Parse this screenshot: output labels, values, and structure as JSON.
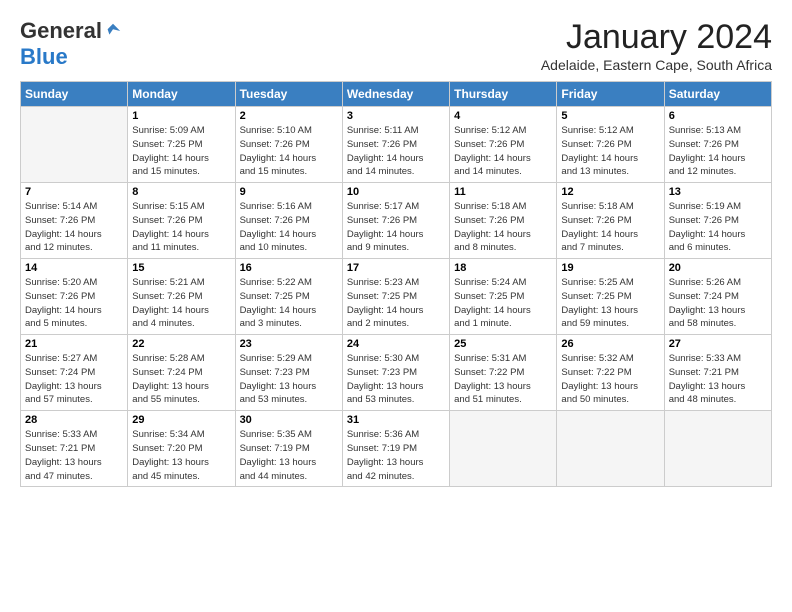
{
  "logo": {
    "general": "General",
    "blue": "Blue"
  },
  "title": "January 2024",
  "subtitle": "Adelaide, Eastern Cape, South Africa",
  "days_of_week": [
    "Sunday",
    "Monday",
    "Tuesday",
    "Wednesday",
    "Thursday",
    "Friday",
    "Saturday"
  ],
  "weeks": [
    [
      {
        "date": "",
        "info": ""
      },
      {
        "date": "1",
        "info": "Sunrise: 5:09 AM\nSunset: 7:25 PM\nDaylight: 14 hours\nand 15 minutes."
      },
      {
        "date": "2",
        "info": "Sunrise: 5:10 AM\nSunset: 7:26 PM\nDaylight: 14 hours\nand 15 minutes."
      },
      {
        "date": "3",
        "info": "Sunrise: 5:11 AM\nSunset: 7:26 PM\nDaylight: 14 hours\nand 14 minutes."
      },
      {
        "date": "4",
        "info": "Sunrise: 5:12 AM\nSunset: 7:26 PM\nDaylight: 14 hours\nand 14 minutes."
      },
      {
        "date": "5",
        "info": "Sunrise: 5:12 AM\nSunset: 7:26 PM\nDaylight: 14 hours\nand 13 minutes."
      },
      {
        "date": "6",
        "info": "Sunrise: 5:13 AM\nSunset: 7:26 PM\nDaylight: 14 hours\nand 12 minutes."
      }
    ],
    [
      {
        "date": "7",
        "info": "Sunrise: 5:14 AM\nSunset: 7:26 PM\nDaylight: 14 hours\nand 12 minutes."
      },
      {
        "date": "8",
        "info": "Sunrise: 5:15 AM\nSunset: 7:26 PM\nDaylight: 14 hours\nand 11 minutes."
      },
      {
        "date": "9",
        "info": "Sunrise: 5:16 AM\nSunset: 7:26 PM\nDaylight: 14 hours\nand 10 minutes."
      },
      {
        "date": "10",
        "info": "Sunrise: 5:17 AM\nSunset: 7:26 PM\nDaylight: 14 hours\nand 9 minutes."
      },
      {
        "date": "11",
        "info": "Sunrise: 5:18 AM\nSunset: 7:26 PM\nDaylight: 14 hours\nand 8 minutes."
      },
      {
        "date": "12",
        "info": "Sunrise: 5:18 AM\nSunset: 7:26 PM\nDaylight: 14 hours\nand 7 minutes."
      },
      {
        "date": "13",
        "info": "Sunrise: 5:19 AM\nSunset: 7:26 PM\nDaylight: 14 hours\nand 6 minutes."
      }
    ],
    [
      {
        "date": "14",
        "info": "Sunrise: 5:20 AM\nSunset: 7:26 PM\nDaylight: 14 hours\nand 5 minutes."
      },
      {
        "date": "15",
        "info": "Sunrise: 5:21 AM\nSunset: 7:26 PM\nDaylight: 14 hours\nand 4 minutes."
      },
      {
        "date": "16",
        "info": "Sunrise: 5:22 AM\nSunset: 7:25 PM\nDaylight: 14 hours\nand 3 minutes."
      },
      {
        "date": "17",
        "info": "Sunrise: 5:23 AM\nSunset: 7:25 PM\nDaylight: 14 hours\nand 2 minutes."
      },
      {
        "date": "18",
        "info": "Sunrise: 5:24 AM\nSunset: 7:25 PM\nDaylight: 14 hours\nand 1 minute."
      },
      {
        "date": "19",
        "info": "Sunrise: 5:25 AM\nSunset: 7:25 PM\nDaylight: 13 hours\nand 59 minutes."
      },
      {
        "date": "20",
        "info": "Sunrise: 5:26 AM\nSunset: 7:24 PM\nDaylight: 13 hours\nand 58 minutes."
      }
    ],
    [
      {
        "date": "21",
        "info": "Sunrise: 5:27 AM\nSunset: 7:24 PM\nDaylight: 13 hours\nand 57 minutes."
      },
      {
        "date": "22",
        "info": "Sunrise: 5:28 AM\nSunset: 7:24 PM\nDaylight: 13 hours\nand 55 minutes."
      },
      {
        "date": "23",
        "info": "Sunrise: 5:29 AM\nSunset: 7:23 PM\nDaylight: 13 hours\nand 53 minutes."
      },
      {
        "date": "24",
        "info": "Sunrise: 5:30 AM\nSunset: 7:23 PM\nDaylight: 13 hours\nand 53 minutes."
      },
      {
        "date": "25",
        "info": "Sunrise: 5:31 AM\nSunset: 7:22 PM\nDaylight: 13 hours\nand 51 minutes."
      },
      {
        "date": "26",
        "info": "Sunrise: 5:32 AM\nSunset: 7:22 PM\nDaylight: 13 hours\nand 50 minutes."
      },
      {
        "date": "27",
        "info": "Sunrise: 5:33 AM\nSunset: 7:21 PM\nDaylight: 13 hours\nand 48 minutes."
      }
    ],
    [
      {
        "date": "28",
        "info": "Sunrise: 5:33 AM\nSunset: 7:21 PM\nDaylight: 13 hours\nand 47 minutes."
      },
      {
        "date": "29",
        "info": "Sunrise: 5:34 AM\nSunset: 7:20 PM\nDaylight: 13 hours\nand 45 minutes."
      },
      {
        "date": "30",
        "info": "Sunrise: 5:35 AM\nSunset: 7:19 PM\nDaylight: 13 hours\nand 44 minutes."
      },
      {
        "date": "31",
        "info": "Sunrise: 5:36 AM\nSunset: 7:19 PM\nDaylight: 13 hours\nand 42 minutes."
      },
      {
        "date": "",
        "info": ""
      },
      {
        "date": "",
        "info": ""
      },
      {
        "date": "",
        "info": ""
      }
    ]
  ]
}
